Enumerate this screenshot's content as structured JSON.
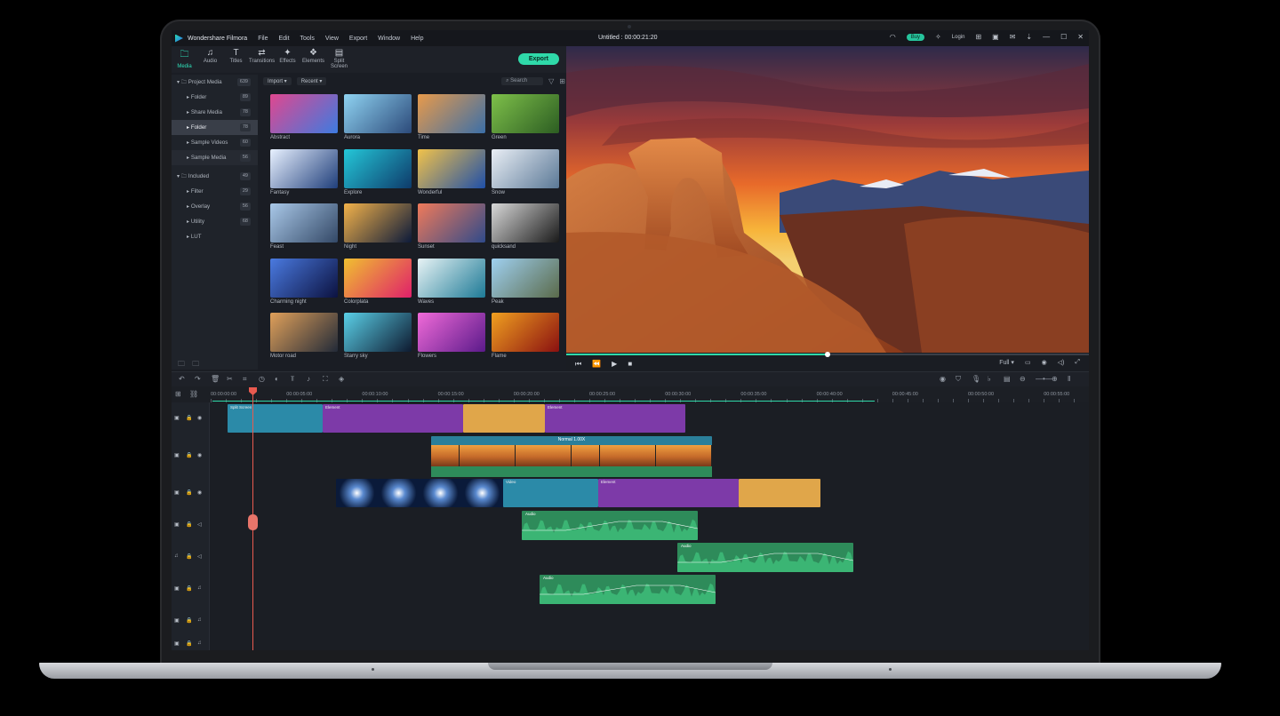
{
  "app": {
    "name": "Wondershare Filmora",
    "menu": [
      "File",
      "Edit",
      "Tools",
      "View",
      "Export",
      "Window",
      "Help"
    ],
    "doc_title": "Untitled : 00:00:21:20",
    "pill": "Buy",
    "login": "Login"
  },
  "toolbar": {
    "tabs": [
      {
        "label": "Media",
        "icon": "folder-icon"
      },
      {
        "label": "Audio",
        "icon": "music-note-icon"
      },
      {
        "label": "Titles",
        "icon": "text-icon"
      },
      {
        "label": "Transitions",
        "icon": "transitions-icon"
      },
      {
        "label": "Effects",
        "icon": "effects-icon"
      },
      {
        "label": "Elements",
        "icon": "elements-icon"
      },
      {
        "label": "Split Screen",
        "icon": "split-screen-icon"
      }
    ],
    "active": "Media",
    "export_label": "Export"
  },
  "sidebar": {
    "items": [
      {
        "label": "Project Media",
        "count": "639",
        "level": 0
      },
      {
        "label": "Folder",
        "count": "89",
        "level": 1
      },
      {
        "label": "Share Media",
        "count": "78",
        "level": 1
      },
      {
        "label": "Folder",
        "count": "78",
        "level": 1,
        "selected": true
      },
      {
        "label": "Sample Videos",
        "count": "60",
        "level": 1
      },
      {
        "label": "Sample Media",
        "count": "56",
        "level": 1
      },
      {
        "label": "Included",
        "count": "49",
        "level": 0
      },
      {
        "label": "Filter",
        "count": "29",
        "level": 1
      },
      {
        "label": "Overlay",
        "count": "56",
        "level": 1
      },
      {
        "label": "Utility",
        "count": "68",
        "level": 1
      },
      {
        "label": "LUT",
        "count": "",
        "level": 1
      }
    ]
  },
  "media_bar": {
    "import": "Import",
    "sort": "Recent",
    "search_placeholder": "Search"
  },
  "media": [
    {
      "label": "Abstract",
      "c1": "#e0478f",
      "c2": "#3d7be0"
    },
    {
      "label": "Aurora",
      "c1": "#8fd3f2",
      "c2": "#2c4a7a"
    },
    {
      "label": "Time",
      "c1": "#e89a4a",
      "c2": "#3b6fa8"
    },
    {
      "label": "Green",
      "c1": "#7ec04a",
      "c2": "#2c5d22"
    },
    {
      "label": "Fantasy",
      "c1": "#e8f1ff",
      "c2": "#1f3e7a"
    },
    {
      "label": "Explore",
      "c1": "#24c7d8",
      "c2": "#0e3a6a"
    },
    {
      "label": "Wonderful",
      "c1": "#f1c24a",
      "c2": "#1f4fa8"
    },
    {
      "label": "Snow",
      "c1": "#e9eef5",
      "c2": "#5a7896"
    },
    {
      "label": "Feast",
      "c1": "#a9c8e8",
      "c2": "#334866"
    },
    {
      "label": "Night",
      "c1": "#f3b24a",
      "c2": "#0c1a3a"
    },
    {
      "label": "Sunset",
      "c1": "#f07a5a",
      "c2": "#2f4a8a"
    },
    {
      "label": "quicksand",
      "c1": "#d8d8d8",
      "c2": "#1a1a1a"
    },
    {
      "label": "Charming night",
      "c1": "#4a7ae0",
      "c2": "#0c1240"
    },
    {
      "label": "Colorplata",
      "c1": "#f0c030",
      "c2": "#e0206a"
    },
    {
      "label": "Waves",
      "c1": "#e8f3f5",
      "c2": "#1d7a96"
    },
    {
      "label": "Peak",
      "c1": "#9fd0f0",
      "c2": "#5a6a4a"
    },
    {
      "label": "Motor road",
      "c1": "#e0a05a",
      "c2": "#222a38"
    },
    {
      "label": "Starry sky",
      "c1": "#5ad0e8",
      "c2": "#0e1a30"
    },
    {
      "label": "Flowers",
      "c1": "#f06ad8",
      "c2": "#5a1a8a"
    },
    {
      "label": "Flame",
      "c1": "#f0a020",
      "c2": "#8a1010"
    }
  ],
  "preview": {
    "progress": 0.5,
    "quality": "Full"
  },
  "timeline": {
    "ticks": [
      "00:00:00:00",
      "00:00:05:00",
      "00:00:10:00",
      "00:00:15:00",
      "00:00:20:00",
      "00:00:25:00",
      "00:00:30:00",
      "00:00:35:00",
      "00:00:40:00",
      "00:00:45:00",
      "00:00:50:00",
      "00:00:55:00"
    ],
    "speed_label": "Normal 1.00X",
    "clip_labels": {
      "split": "Split Screen",
      "element": "Element",
      "video": "Video",
      "audio": "Audio"
    }
  },
  "colors": {
    "accent": "#2fd9a9",
    "teal": "#2b8aa8",
    "purple": "#7d3aa8",
    "orange": "#e0a64a",
    "audio": "#2e8b5a",
    "playhead": "#ea5a4f"
  }
}
